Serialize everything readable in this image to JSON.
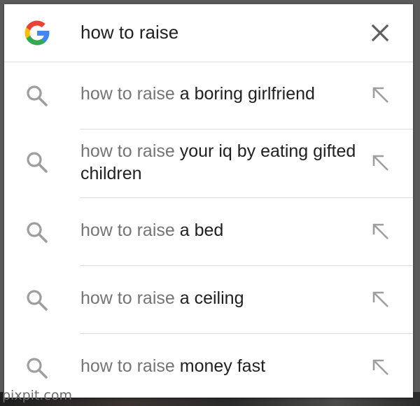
{
  "search": {
    "query": "how to raise",
    "logo_icon": "google-g-logo",
    "clear_icon": "close-icon"
  },
  "suggestions": [
    {
      "prefix": "how to raise",
      "completion": " a boring girlfriend"
    },
    {
      "prefix": "how to raise",
      "completion": " your iq by eating gifted children"
    },
    {
      "prefix": "how to raise",
      "completion": " a bed"
    },
    {
      "prefix": "how to raise",
      "completion": " a ceiling"
    },
    {
      "prefix": "how to raise",
      "completion": " money fast"
    }
  ],
  "row_icons": {
    "leading": "search-icon",
    "trailing": "arrow-up-left-icon"
  },
  "watermark": "pixpit.com",
  "colors": {
    "prefix_text": "#757575",
    "completion_text": "#212121",
    "icon_gray": "#9e9e9e",
    "google_blue": "#4285F4",
    "google_red": "#EA4335",
    "google_yellow": "#FBBC05",
    "google_green": "#34A853"
  }
}
